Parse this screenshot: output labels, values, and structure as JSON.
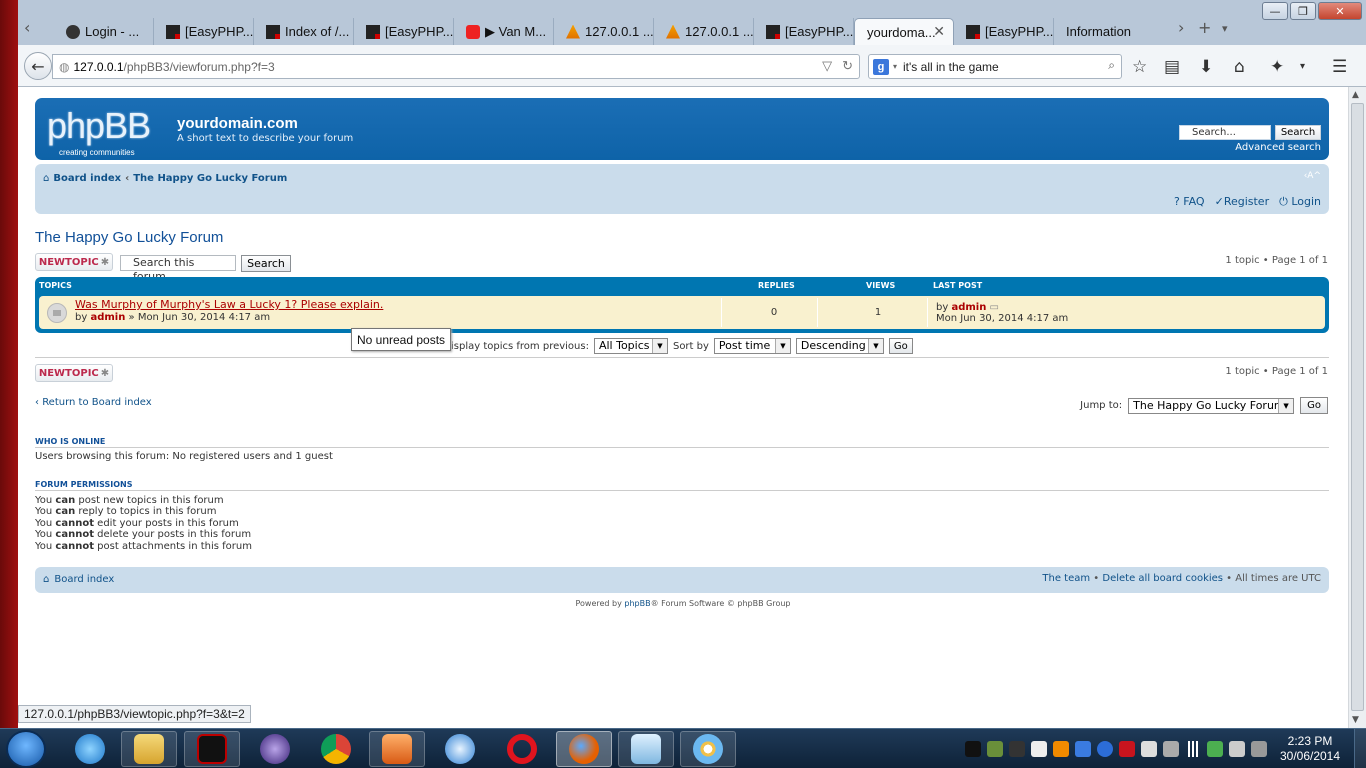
{
  "browser": {
    "tabs": [
      {
        "label": "Login - ...",
        "icon": "login-favicon"
      },
      {
        "label": "[EasyPHP...",
        "icon": "easyphp-favicon"
      },
      {
        "label": "Index of /...",
        "icon": "easyphp-favicon"
      },
      {
        "label": "[EasyPHP...",
        "icon": "easyphp-favicon"
      },
      {
        "label": "▶ Van M...",
        "icon": "youtube-favicon"
      },
      {
        "label": "127.0.0.1 ...",
        "icon": "phpmyadmin-favicon"
      },
      {
        "label": "127.0.0.1 ...",
        "icon": "phpmyadmin-favicon"
      },
      {
        "label": "[EasyPHP...",
        "icon": "easyphp-favicon"
      },
      {
        "label": "yourdoma...",
        "icon": "none",
        "active": true
      },
      {
        "label": "[EasyPHP...",
        "icon": "easyphp-favicon"
      },
      {
        "label": "Information",
        "icon": "none"
      }
    ],
    "url_host": "127.0.0.1",
    "url_path": "/phpBB3/viewforum.php?f=3",
    "search_value": "it's all in the game",
    "search_engine_icon": "g",
    "status_url": "127.0.0.1/phpBB3/viewtopic.php?f=3&t=2"
  },
  "header": {
    "logo_text": "phpBB",
    "logo_tagline": "creating    communities",
    "site_title": "yourdomain.com",
    "site_description": "A short text to describe your forum",
    "search_placeholder": "Search...",
    "search_button": "Search",
    "advanced_search": "Advanced search"
  },
  "nav": {
    "breadcrumb_home": "Board index",
    "breadcrumb_sep": "‹",
    "breadcrumb_current": "The Happy Go Lucky Forum",
    "font_size": "‹A^",
    "faq": "FAQ",
    "register": "Register",
    "login": "Login"
  },
  "forum": {
    "title": "The Happy Go Lucky Forum",
    "new_topic": "NEWTOPIC",
    "new_topic_star": "✱",
    "search_placeholder": "Search this forum...",
    "search_button": "Search",
    "pagination": "1 topic • Page 1 of 1"
  },
  "topics_table": {
    "headers": {
      "topics": "TOPICS",
      "replies": "REPLIES",
      "views": "VIEWS",
      "last_post": "LAST POST"
    },
    "rows": [
      {
        "title": "Was Murphy of Murphy's Law a Lucky 1? Please explain.",
        "by_prefix": "by",
        "author": "admin",
        "date": "» Mon Jun 30, 2014 4:17 am",
        "replies": "0",
        "views": "1",
        "last_by_prefix": "by",
        "last_author": "admin",
        "last_date": "Mon Jun 30, 2014 4:17 am"
      }
    ]
  },
  "tooltip": "No unread posts",
  "sort": {
    "display_label": "isplay topics from previous:",
    "display_value": "All Topics",
    "sort_by_label": "Sort by",
    "sort_by_value": "Post time",
    "order_value": "Descending",
    "go": "Go"
  },
  "bottom": {
    "return_text": "Return to Board index",
    "jump_label": "Jump to:",
    "jump_value": "The Happy Go Lucky Forum",
    "jump_go": "Go"
  },
  "who_is_online": {
    "title": "WHO IS ONLINE",
    "text": "Users browsing this forum: No registered users and 1 guest"
  },
  "permissions": {
    "title": "FORUM PERMISSIONS",
    "lines": [
      {
        "pre": "You ",
        "strong": "can",
        "post": " post new topics in this forum"
      },
      {
        "pre": "You ",
        "strong": "can",
        "post": " reply to topics in this forum"
      },
      {
        "pre": "You ",
        "strong": "cannot",
        "post": " edit your posts in this forum"
      },
      {
        "pre": "You ",
        "strong": "cannot",
        "post": " delete your posts in this forum"
      },
      {
        "pre": "You ",
        "strong": "cannot",
        "post": " post attachments in this forum"
      }
    ]
  },
  "footer": {
    "board_index": "Board index",
    "the_team": "The team",
    "sep": " • ",
    "delete_cookies": "Delete all board cookies",
    "times": "All times are UTC",
    "powered_pre": "Powered by ",
    "powered_link": "phpBB",
    "powered_post": "® Forum Software © phpBB Group"
  },
  "taskbar": {
    "time": "2:23 PM",
    "date": "30/06/2014",
    "apps": [
      "internet-explorer",
      "file-explorer",
      "easyphp",
      "eclipse",
      "chrome",
      "media-player",
      "safari",
      "opera",
      "firefox",
      "notepad",
      "paint"
    ]
  },
  "colors": {
    "phpbb_blue": "#0e63a8",
    "nav_bg": "#cadceb",
    "topic_row": "#f9f1cf",
    "link": "#105289",
    "topic_link": "#aa0000",
    "new_topic": "#bc2a4d"
  }
}
